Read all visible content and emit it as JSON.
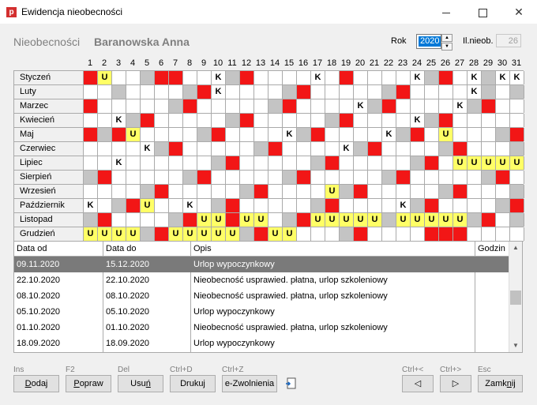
{
  "window": {
    "title": "Ewidencja nieobecności",
    "app_icon_letter": "p"
  },
  "header": {
    "title": "Nieobecności",
    "employee": "Baranowska Anna",
    "year_label": "Rok",
    "year_value": "2020",
    "count_label": "Il.nieob.",
    "count_value": "26"
  },
  "days": [
    "1",
    "2",
    "3",
    "4",
    "5",
    "6",
    "7",
    "8",
    "9",
    "10",
    "11",
    "12",
    "13",
    "14",
    "15",
    "16",
    "17",
    "18",
    "19",
    "20",
    "21",
    "22",
    "23",
    "24",
    "25",
    "26",
    "27",
    "28",
    "29",
    "30",
    "31"
  ],
  "legend_colors": {
    "r": "#f21616",
    "g": "#c4c4c4",
    "y": "#ffff66",
    "w": "#ffffff"
  },
  "calendar": [
    {
      "month": "Styczeń",
      "cells": [
        "r",
        "U",
        "",
        "",
        "g",
        "r",
        "r",
        "",
        "",
        "K",
        "g",
        "r",
        "",
        "",
        "",
        "",
        "K",
        "",
        "r",
        "",
        "",
        "",
        "",
        "K",
        "g",
        "r",
        "",
        "K",
        "g",
        "K",
        "K"
      ]
    },
    {
      "month": "Luty",
      "cells": [
        "",
        "",
        "g",
        "",
        "",
        "",
        "",
        "g",
        "r",
        "K",
        "",
        "",
        "",
        "",
        "g",
        "r",
        "",
        "",
        "",
        "",
        "",
        "g",
        "r",
        "",
        "",
        "",
        "",
        "K",
        "g",
        "",
        "x"
      ]
    },
    {
      "month": "Marzec",
      "cells": [
        "r",
        "",
        "",
        "",
        "",
        "",
        "g",
        "r",
        "",
        "",
        "",
        "",
        "",
        "g",
        "r",
        "",
        "",
        "",
        "",
        "K",
        "g",
        "r",
        "",
        "",
        "",
        "",
        "K",
        "g",
        "r",
        "",
        ""
      ]
    },
    {
      "month": "Kwiecień",
      "cells": [
        "",
        "",
        "K",
        "g",
        "r",
        "",
        "",
        "",
        "",
        "",
        "g",
        "r",
        "",
        "",
        "",
        "",
        "",
        "g",
        "r",
        "",
        "",
        "",
        "",
        "K",
        "g",
        "r",
        "",
        "",
        "",
        "",
        ""
      ]
    },
    {
      "month": "Maj",
      "cells": [
        "r",
        "g",
        "r",
        "U",
        "",
        "",
        "",
        "",
        "g",
        "r",
        "",
        "",
        "",
        "",
        "K",
        "g",
        "r",
        "",
        "",
        "",
        "",
        "K",
        "g",
        "r",
        "",
        "U",
        "",
        "",
        "",
        "g",
        "r"
      ]
    },
    {
      "month": "Czerwiec",
      "cells": [
        "",
        "",
        "",
        "",
        "K",
        "g",
        "r",
        "",
        "",
        "",
        "",
        "",
        "g",
        "r",
        "",
        "",
        "",
        "",
        "K",
        "g",
        "r",
        "",
        "",
        "",
        "",
        "g",
        "r",
        "",
        "",
        "",
        "x"
      ]
    },
    {
      "month": "Lipiec",
      "cells": [
        "",
        "",
        "K",
        "",
        "",
        "",
        "",
        "",
        "",
        "g",
        "r",
        "",
        "",
        "",
        "",
        "",
        "g",
        "r",
        "",
        "",
        "",
        "",
        "",
        "g",
        "r",
        "",
        "U",
        "U",
        "U",
        "U",
        "U"
      ]
    },
    {
      "month": "Sierpień",
      "cells": [
        "g",
        "r",
        "",
        "",
        "",
        "",
        "",
        "g",
        "r",
        "",
        "",
        "",
        "",
        "",
        "g",
        "r",
        "",
        "",
        "",
        "",
        "",
        "g",
        "r",
        "",
        "",
        "",
        "",
        "",
        "g",
        "r",
        ""
      ]
    },
    {
      "month": "Wrzesień",
      "cells": [
        "",
        "",
        "",
        "",
        "g",
        "r",
        "",
        "",
        "",
        "",
        "",
        "g",
        "r",
        "",
        "",
        "",
        "",
        "U",
        "g",
        "r",
        "",
        "",
        "",
        "",
        "",
        "g",
        "r",
        "",
        "",
        "",
        "x"
      ]
    },
    {
      "month": "Październik",
      "cells": [
        "K",
        "",
        "g",
        "r",
        "U",
        "",
        "",
        "K",
        "",
        "g",
        "r",
        "",
        "",
        "",
        "",
        "",
        "g",
        "r",
        "",
        "",
        "",
        "",
        "K",
        "g",
        "r",
        "",
        "",
        "",
        "",
        "g",
        "r"
      ]
    },
    {
      "month": "Listopad",
      "cells": [
        "g",
        "r",
        "",
        "",
        "",
        "",
        "g",
        "r",
        "U",
        "U",
        "r",
        "U",
        "U",
        "",
        "g",
        "r",
        "U",
        "U",
        "U",
        "U",
        "U",
        "g",
        "U",
        "U",
        "U",
        "U",
        "U",
        "g",
        "r",
        "",
        "x"
      ]
    },
    {
      "month": "Grudzień",
      "cells": [
        "U",
        "U",
        "U",
        "U",
        "g",
        "r",
        "U",
        "U",
        "U",
        "U",
        "U",
        "g",
        "r",
        "U",
        "U",
        "",
        "",
        "",
        "g",
        "r",
        "",
        "",
        "",
        "",
        "r",
        "r",
        "r",
        "",
        "",
        "",
        ""
      ]
    }
  ],
  "table": {
    "columns": [
      "Data od",
      "Data do",
      "Opis",
      "Godzin"
    ],
    "rows": [
      [
        "09.11.2020",
        "15.12.2020",
        "Urlop wypoczynkowy",
        ""
      ],
      [
        "22.10.2020",
        "22.10.2020",
        "Nieobecność usprawied. płatna, urlop szkoleniowy",
        ""
      ],
      [
        "08.10.2020",
        "08.10.2020",
        "Nieobecność usprawied. płatna, urlop szkoleniowy",
        ""
      ],
      [
        "05.10.2020",
        "05.10.2020",
        "Urlop wypoczynkowy",
        ""
      ],
      [
        "01.10.2020",
        "01.10.2020",
        "Nieobecność usprawied. płatna, urlop szkoleniowy",
        ""
      ],
      [
        "18.09.2020",
        "18.09.2020",
        "Urlop wypoczynkowy",
        ""
      ]
    ]
  },
  "buttons": {
    "add": {
      "shortcut": "Ins",
      "label_u": "D",
      "label_rest": "odaj"
    },
    "edit": {
      "shortcut": "F2",
      "label_u": "P",
      "label_rest": "opraw"
    },
    "delete": {
      "shortcut": "Del",
      "label_pre": "Usu",
      "label_u": "ń"
    },
    "print": {
      "shortcut": "Ctrl+D",
      "label": "Drukuj"
    },
    "ezwolnienia": {
      "shortcut": "Ctrl+Z",
      "label": "e-Zwolnienia"
    },
    "prev": {
      "shortcut": "Ctrl+<"
    },
    "next": {
      "shortcut": "Ctrl+>"
    },
    "close": {
      "shortcut": "Esc",
      "label_pre": "Zamk",
      "label_u": "n",
      "label_rest": "ij"
    }
  }
}
